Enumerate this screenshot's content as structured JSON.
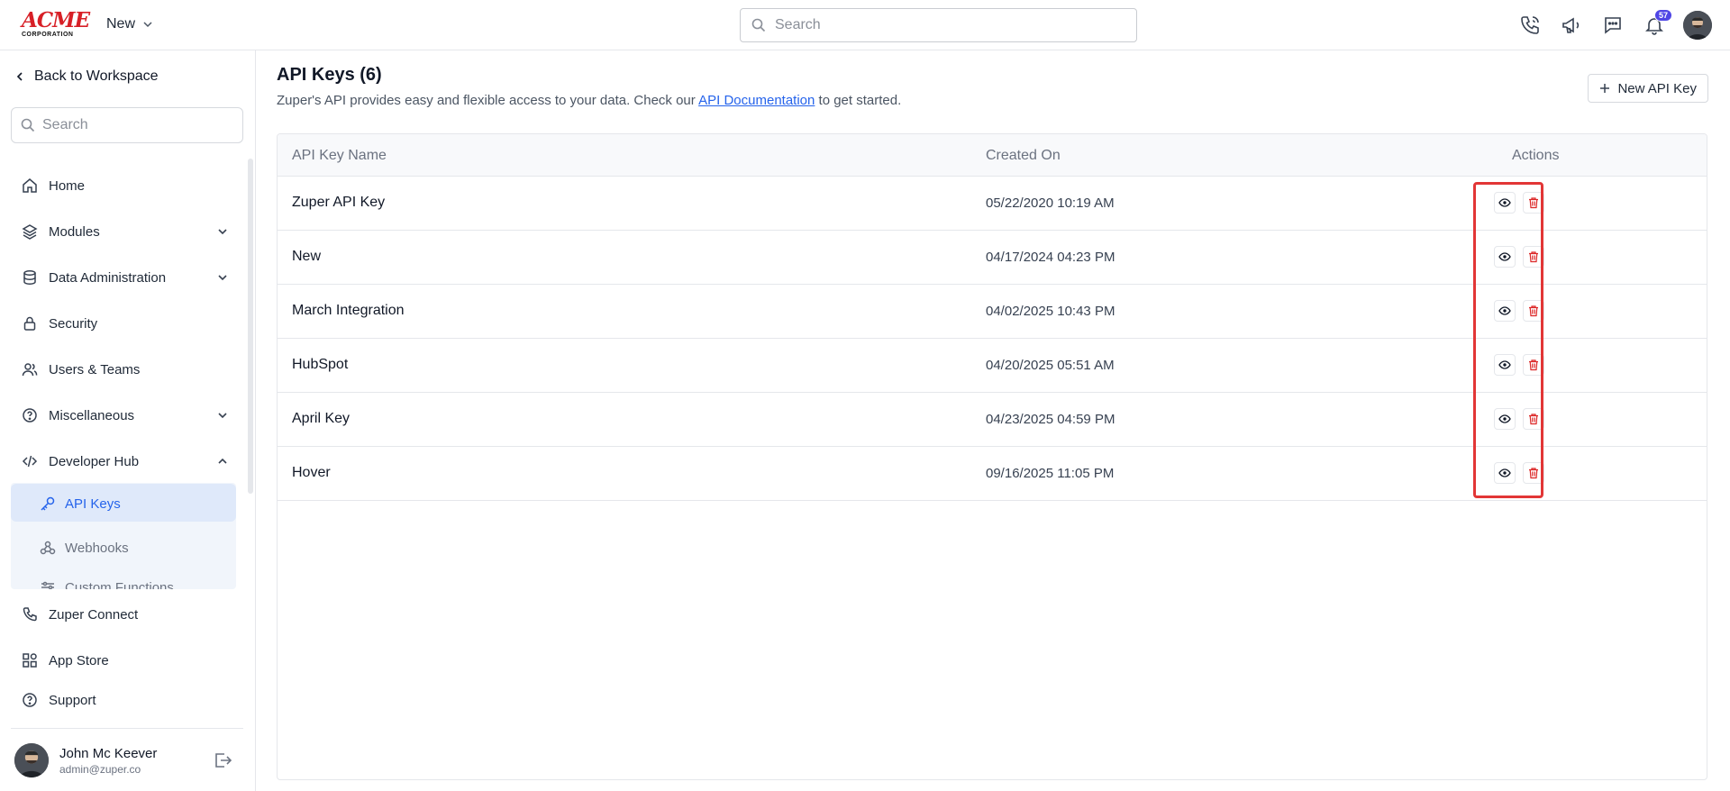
{
  "topbar": {
    "logo_text": "ACME",
    "logo_sub": "CORPORATION",
    "workspace_label": "New",
    "search_placeholder": "Search",
    "notification_count": "57"
  },
  "sidebar": {
    "back_label": "Back to Workspace",
    "search_placeholder": "Search",
    "items": [
      {
        "label": "Home",
        "icon": "home-icon"
      },
      {
        "label": "Modules",
        "icon": "layers-icon"
      },
      {
        "label": "Data Administration",
        "icon": "database-icon"
      },
      {
        "label": "Security",
        "icon": "lock-icon"
      },
      {
        "label": "Users & Teams",
        "icon": "users-icon"
      },
      {
        "label": "Miscellaneous",
        "icon": "help-circle-icon"
      },
      {
        "label": "Developer Hub",
        "icon": "code-icon"
      }
    ],
    "sub_items": [
      {
        "label": "API Keys",
        "icon": "key-icon"
      },
      {
        "label": "Webhooks",
        "icon": "webhook-icon"
      },
      {
        "label": "Custom Functions",
        "icon": "sliders-icon"
      }
    ],
    "bottom_items": [
      {
        "label": "Zuper Connect",
        "icon": "phone-icon"
      },
      {
        "label": "App Store",
        "icon": "grid-icon"
      },
      {
        "label": "Support",
        "icon": "help-circle-icon"
      }
    ],
    "user": {
      "name": "John Mc Keever",
      "email": "admin@zuper.co"
    }
  },
  "main": {
    "title": "API Keys (6)",
    "desc_before": "Zuper's API provides easy and flexible access to your data. Check our ",
    "desc_link": "API Documentation",
    "desc_after": " to get started.",
    "new_button": "New API Key",
    "columns": {
      "name": "API Key Name",
      "created": "Created On",
      "actions": "Actions"
    },
    "rows": [
      {
        "name": "Zuper API Key",
        "created": "05/22/2020 10:19 AM"
      },
      {
        "name": "New",
        "created": "04/17/2024 04:23 PM"
      },
      {
        "name": "March Integration",
        "created": "04/02/2025 10:43 PM"
      },
      {
        "name": "HubSpot",
        "created": "04/20/2025 05:51 AM"
      },
      {
        "name": "April Key",
        "created": "04/23/2025 04:59 PM"
      },
      {
        "name": "Hover",
        "created": "09/16/2025 11:05 PM"
      }
    ]
  },
  "colors": {
    "accent": "#2563eb",
    "danger": "#e23636",
    "brand": "#d71f26",
    "badge": "#4f46e5"
  }
}
